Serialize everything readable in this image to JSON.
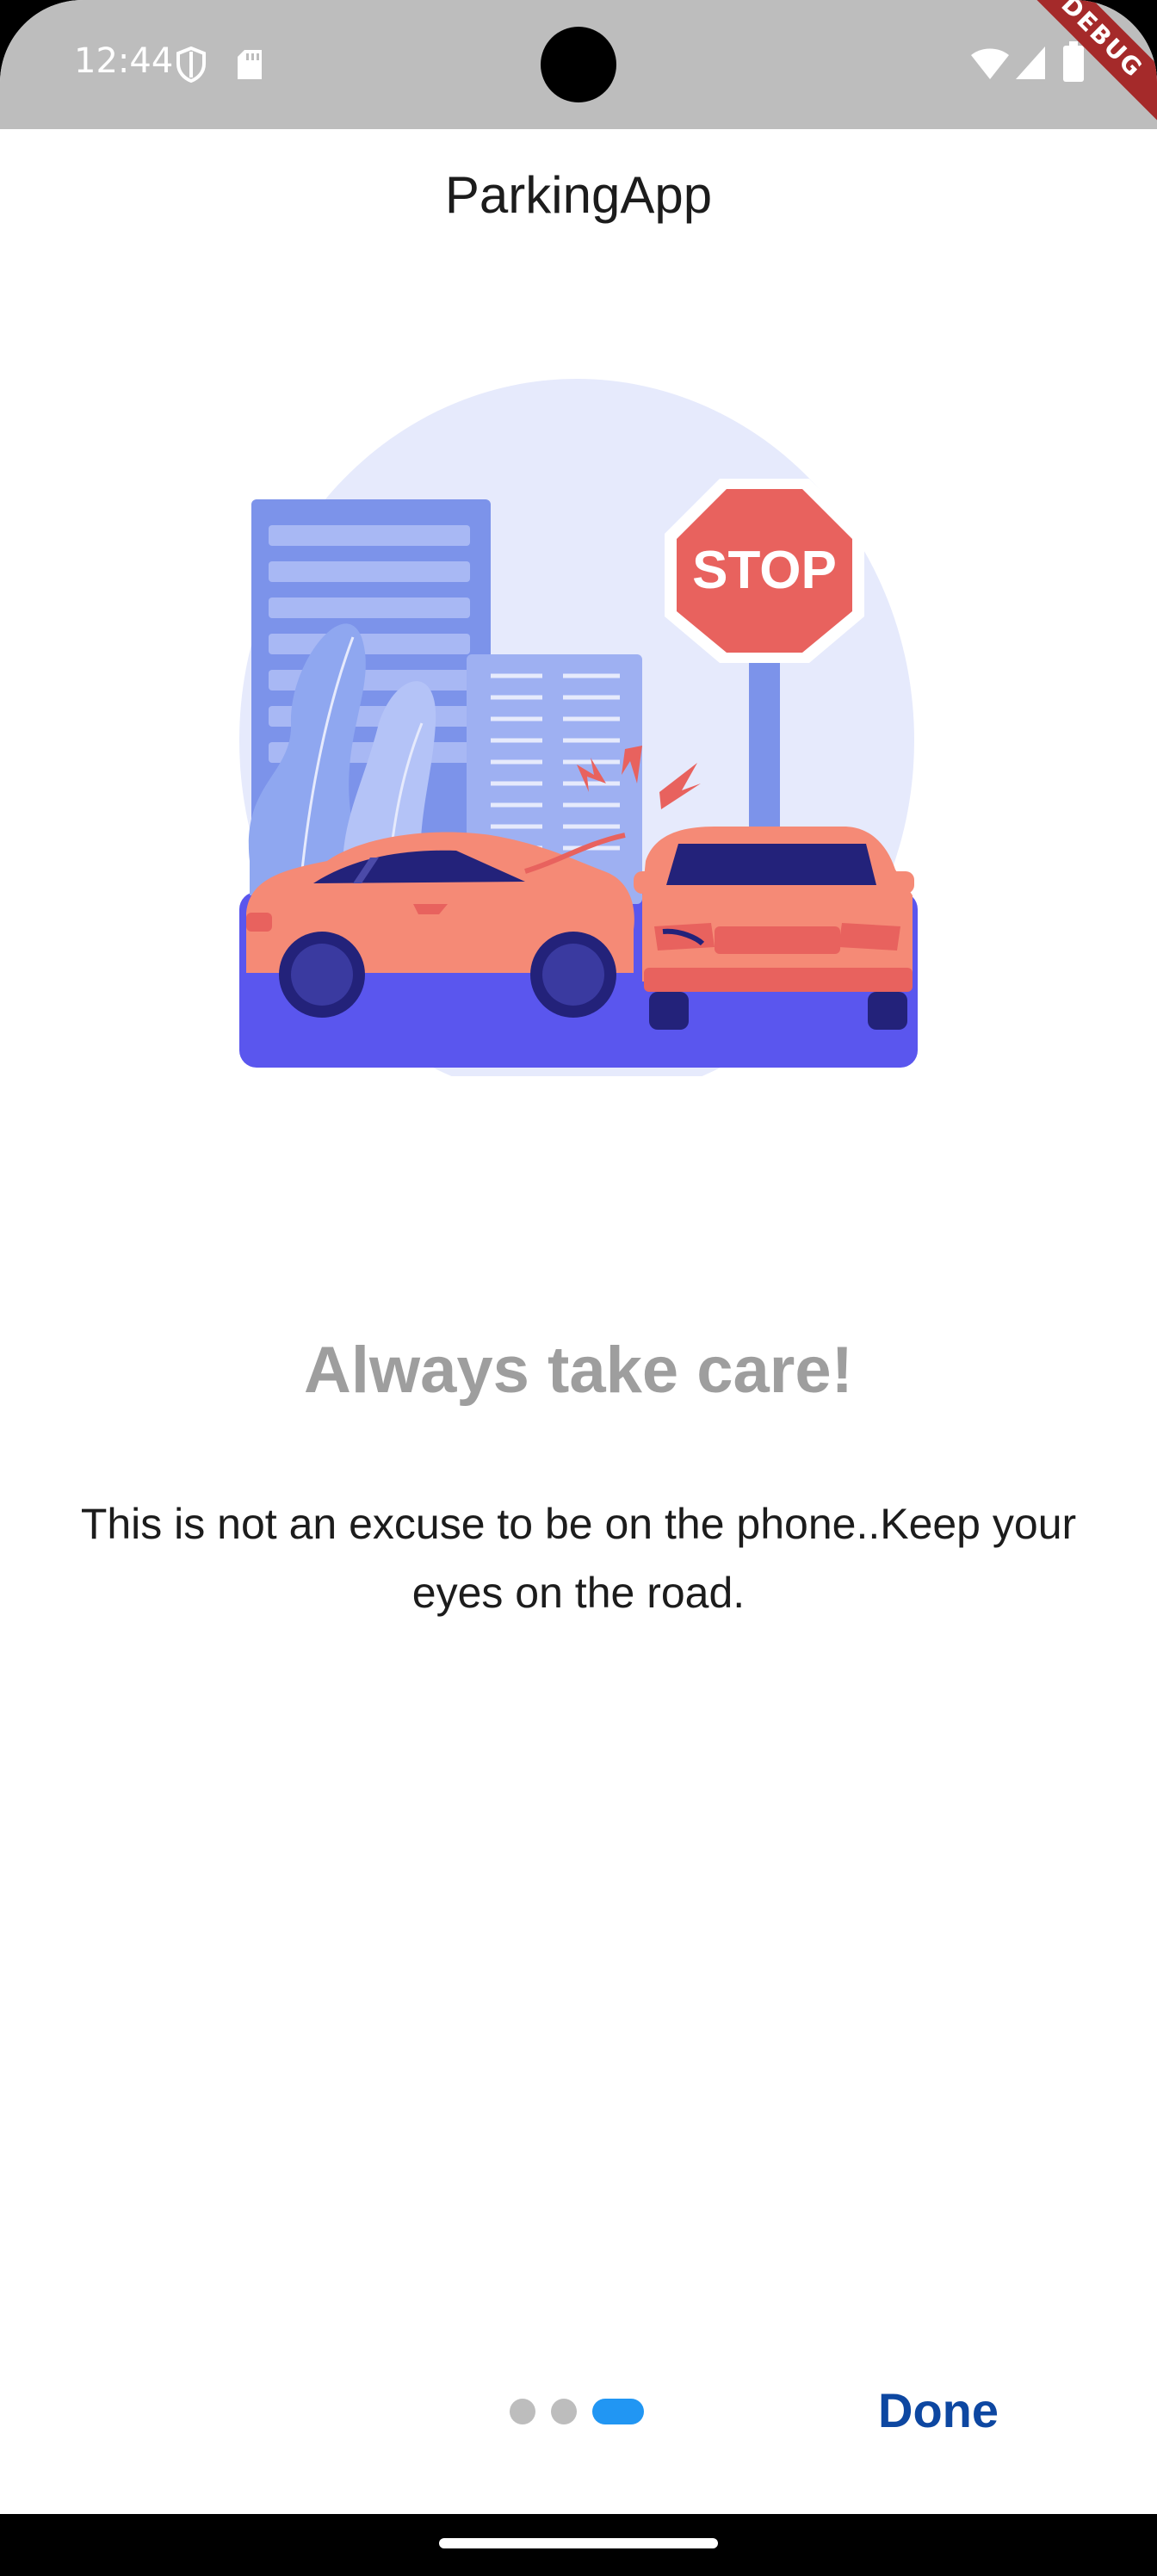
{
  "status_bar": {
    "time": "12:44",
    "icons": [
      "shield-icon",
      "sd-card-icon",
      "wifi-icon",
      "signal-icon",
      "battery-icon"
    ],
    "debug_label": "DEBUG"
  },
  "app_bar": {
    "title": "ParkingApp"
  },
  "page": {
    "illustration": {
      "sign_text": "STOP",
      "name": "car-accident-illustration"
    },
    "heading": "Always take care!",
    "body": "This is not an excuse to be on the phone..Keep your eyes on the road."
  },
  "pager": {
    "count": 3,
    "active_index": 2,
    "done_label": "Done"
  },
  "colors": {
    "status_bar": "#bdbdbd",
    "heading": "#9e9e9e",
    "active_dot": "#2196f3",
    "done": "#0d47a1"
  }
}
